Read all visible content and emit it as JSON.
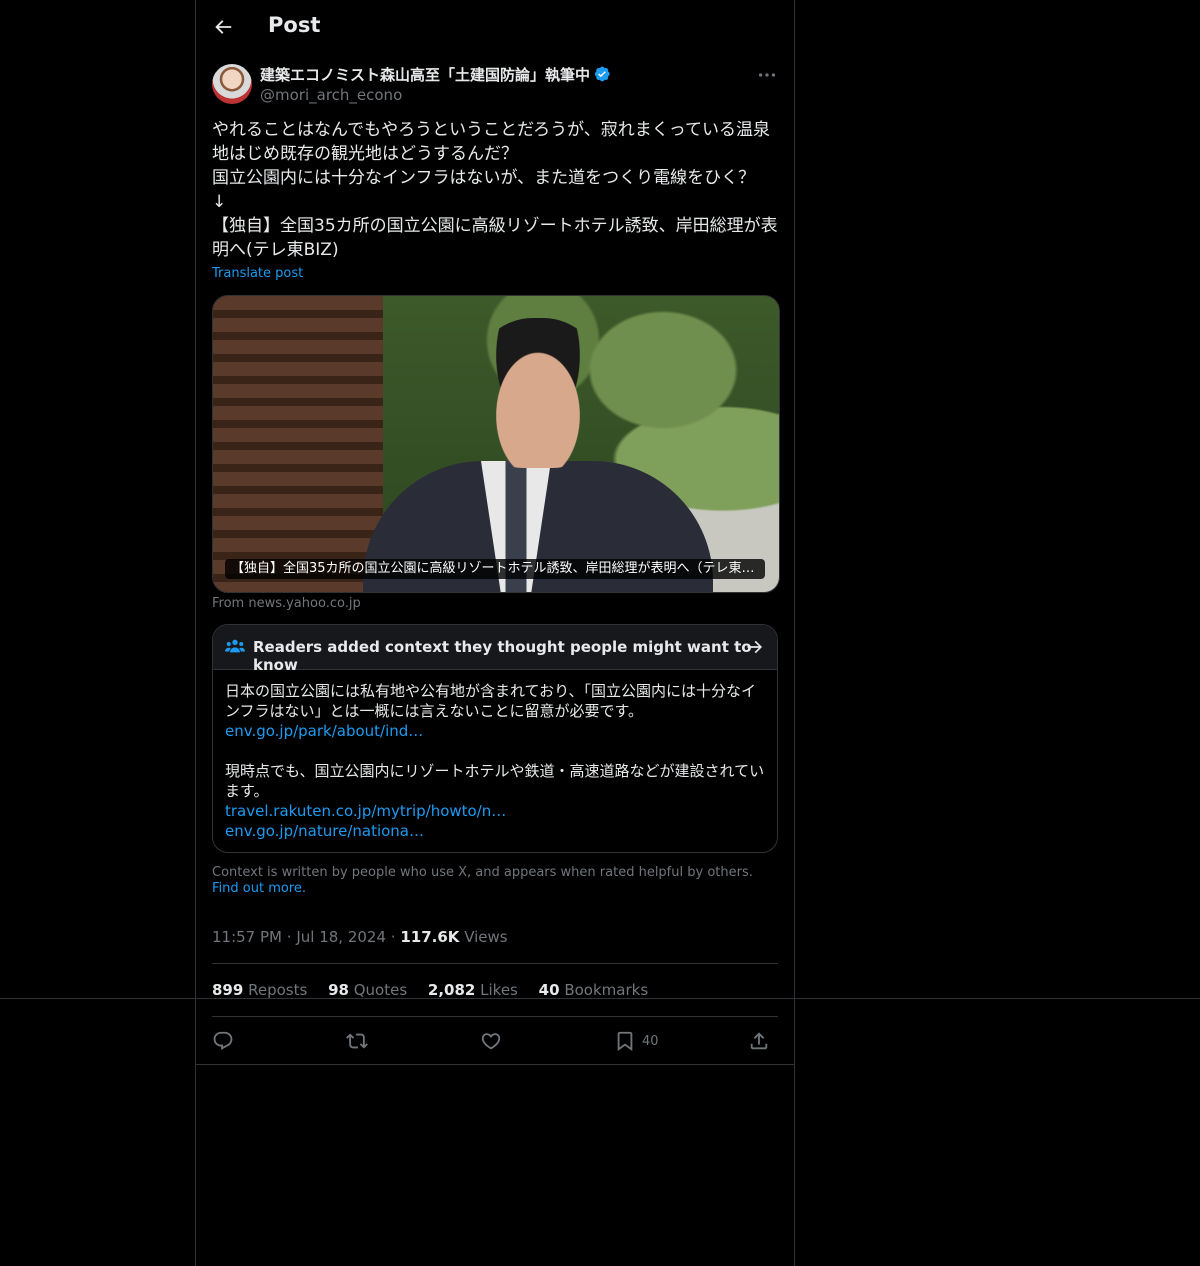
{
  "header": {
    "title": "Post"
  },
  "author": {
    "display_name": "建築エコノミスト森山高至「土建国防論」執筆中",
    "handle": "@mori_arch_econo",
    "verified": true
  },
  "post": {
    "text": "やれることはなんでもやろうということだろうが、寂れまくっている温泉地はじめ既存の観光地はどうするんだ？\n国立公園内には十分なインフラはないが、また道をつくり電線をひく？\n↓\n【独自】全国35カ所の国立公園に高級リゾートホテル誘致、岸田総理が表明へ(テレ東BIZ)",
    "translate_label": "Translate post"
  },
  "media": {
    "caption": "【独自】全国35カ所の国立公園に高級リゾートホテル誘致、岸田総理が表明へ（テレ東BIZ）",
    "source": "From news.yahoo.co.jp"
  },
  "community_note": {
    "title": "Readers added context they thought people might want to know",
    "paragraph1": "日本の国立公園には私有地や公有地が含まれており、「国立公園内には十分なインフラはない」とは一概には言えないことに留意が必要です。",
    "link1": "env.go.jp/park/about/ind…",
    "paragraph2": "現時点でも、国立公園内にリゾートホテルや鉄道・高速道路などが建設されています。",
    "link2": "travel.rakuten.co.jp/mytrip/howto/n…",
    "link3": "env.go.jp/nature/nationa…"
  },
  "disclaimer": {
    "text": "Context is written by people who use X, and appears when rated helpful by others.",
    "find_out": "Find out more."
  },
  "meta": {
    "time": "11:57 PM",
    "dot": "·",
    "date": "Jul 18, 2024",
    "views_count": "117.6K",
    "views_label": "Views"
  },
  "stats": {
    "reposts_count": "899",
    "reposts_label": "Reposts",
    "quotes_count": "98",
    "quotes_label": "Quotes",
    "likes_count": "2,082",
    "likes_label": "Likes",
    "bookmarks_count": "40",
    "bookmarks_label": "Bookmarks"
  },
  "actions": {
    "bookmark_count": "40"
  },
  "colors": {
    "accent": "#1d9bf0",
    "background": "#000000",
    "border": "#2f3336",
    "muted": "#71767b"
  }
}
